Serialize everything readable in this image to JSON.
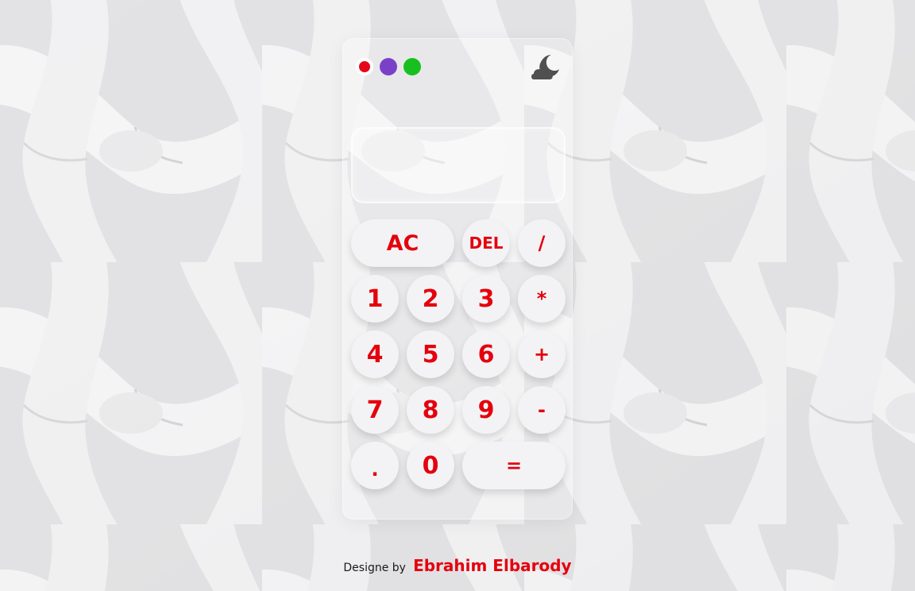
{
  "window_controls": {
    "close": {
      "color": "#e6071a"
    },
    "minimize": {
      "color": "#7a41c8"
    },
    "maximize": {
      "color": "#17c01f"
    }
  },
  "theme_toggle": {
    "icon": "cloud-moon-icon",
    "color": "#505050"
  },
  "display": {
    "value": ""
  },
  "keypad": {
    "ac": "AC",
    "del": "DEL",
    "divide": "/",
    "k1": "1",
    "k2": "2",
    "k3": "3",
    "multiply": "*",
    "k4": "4",
    "k5": "5",
    "k6": "6",
    "plus": "+",
    "k7": "7",
    "k8": "8",
    "k9": "9",
    "minus": "-",
    "dot": ".",
    "k0": "0",
    "equals": "="
  },
  "credit": {
    "prefix": "Designe by",
    "author": "Ebrahim Elbarody"
  },
  "colors": {
    "accent": "#e5000d",
    "key_bg": "#f3f3f5",
    "background": "#ececee"
  }
}
